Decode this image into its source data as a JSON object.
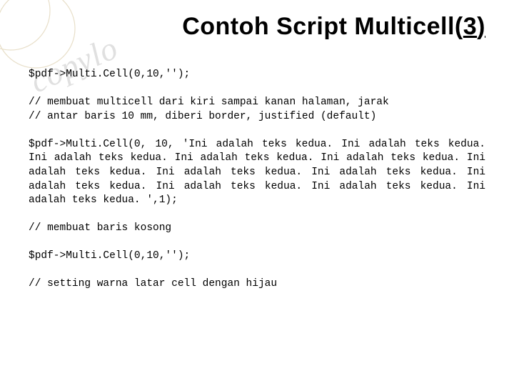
{
  "title": {
    "prefix": "Contoh Script Multicell(",
    "num": "3",
    "suffix": ")"
  },
  "watermark": "copylo",
  "code": "$pdf->Multi.Cell(0,10,'');\n\n// membuat multicell dari kiri sampai kanan halaman, jarak\n// antar baris 10 mm, diberi border, justified (default)\n\n$pdf->Multi.Cell(0, 10, 'Ini adalah teks kedua. Ini adalah teks kedua. Ini adalah teks kedua. Ini adalah teks kedua. Ini adalah teks kedua. Ini adalah teks kedua. Ini adalah teks kedua. Ini adalah teks kedua. Ini adalah teks kedua. Ini adalah teks kedua. Ini adalah teks kedua. Ini adalah teks kedua. ',1);\n\n// membuat baris kosong\n\n$pdf->Multi.Cell(0,10,'');\n\n// setting warna latar cell dengan hijau"
}
